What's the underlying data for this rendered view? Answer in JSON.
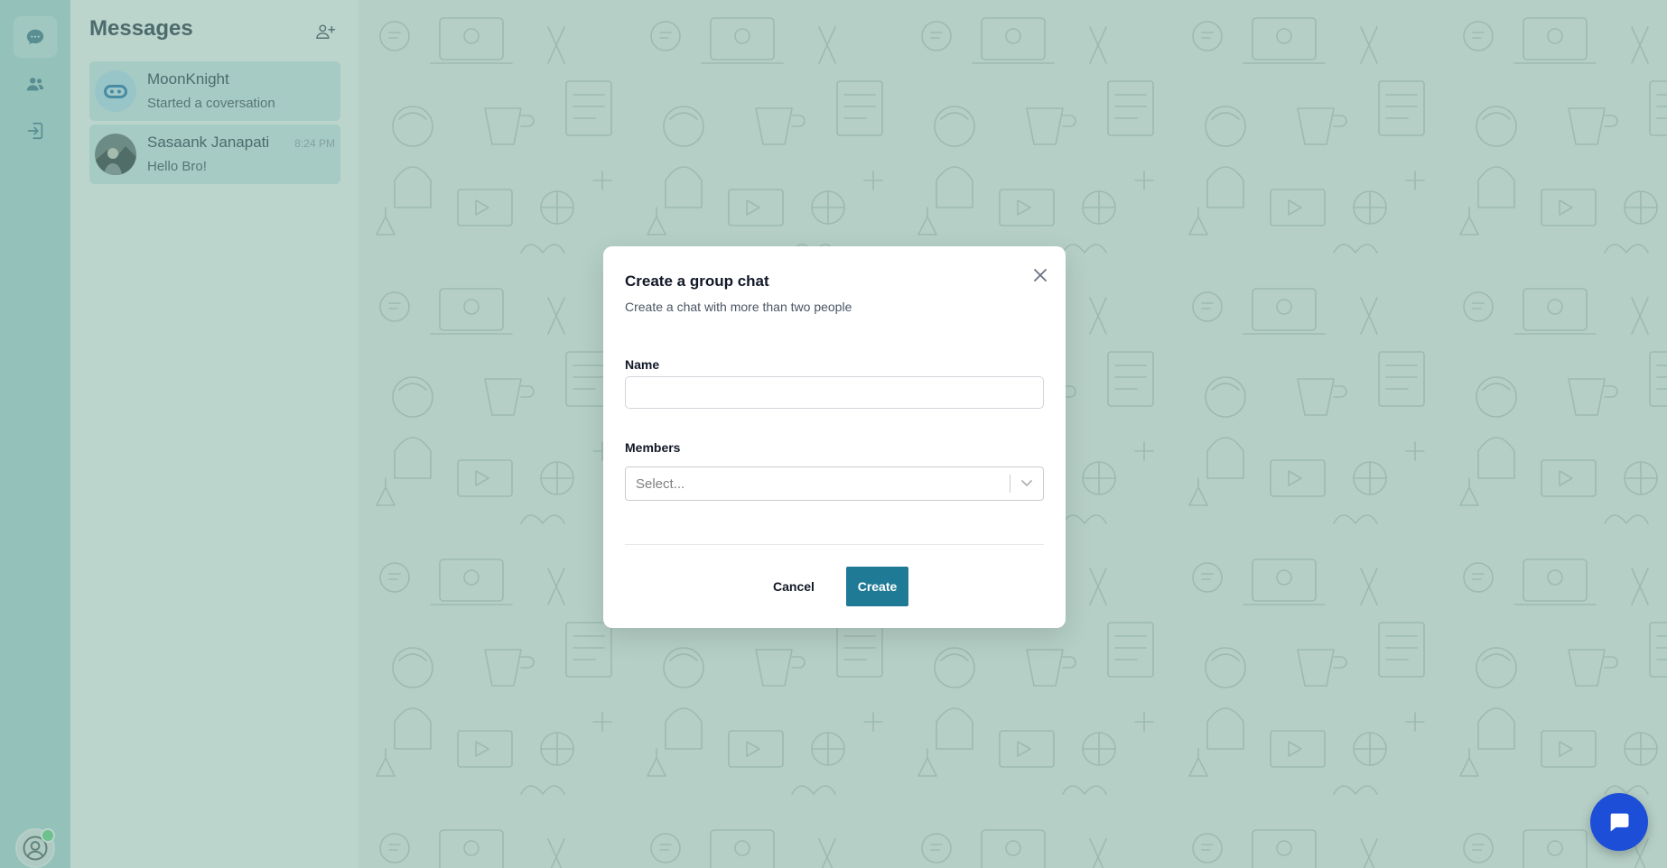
{
  "sidebar": {
    "items": [
      {
        "icon": "chat-bubble-icon",
        "active": true
      },
      {
        "icon": "users-icon",
        "active": false
      },
      {
        "icon": "logout-icon",
        "active": false
      }
    ],
    "user_status": "online"
  },
  "messages_panel": {
    "title": "Messages",
    "new_group_icon": "add-user-icon",
    "conversations": [
      {
        "name": "MoonKnight",
        "preview": "Started a coversation",
        "time": "",
        "avatar": "bot-avatar"
      },
      {
        "name": "Sasaank Janapati",
        "preview": "Hello Bro!",
        "time": "8:24 PM",
        "avatar": "photo-avatar"
      }
    ]
  },
  "modal": {
    "title": "Create a group chat",
    "subtitle": "Create a chat with more than two people",
    "name_label": "Name",
    "name_value": "",
    "members_label": "Members",
    "members_placeholder": "Select...",
    "cancel_label": "Cancel",
    "create_label": "Create"
  },
  "colors": {
    "overlay": "#68a08f",
    "primary_button": "#1f7a95",
    "fab": "#1d4ed8",
    "online": "#6fdc8c"
  },
  "fab": {
    "icon": "message-square-icon"
  }
}
